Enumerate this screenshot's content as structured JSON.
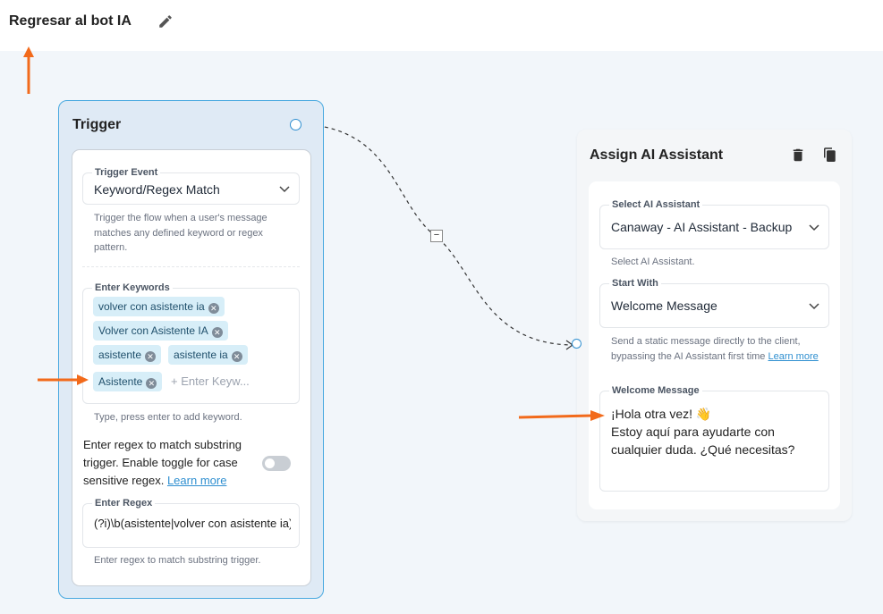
{
  "header": {
    "back_label": "Regresar al bot IA",
    "edit_icon": "pencil-icon"
  },
  "trigger_node": {
    "title": "Trigger",
    "event_label": "Trigger Event",
    "event_value": "Keyword/Regex Match",
    "event_help": "Trigger the flow when a user's message matches any defined keyword or regex pattern.",
    "keywords_label": "Enter Keywords",
    "keywords": [
      "volver con asistente ia",
      "Volver con Asistente IA",
      "asistente",
      "asistente ia",
      "Asistente"
    ],
    "keywords_placeholder": "+ Enter Keyw...",
    "keywords_help": "Type, press enter to add keyword.",
    "regex_toggle_text": "Enter regex to match substring trigger. Enable toggle for case sensitive regex.",
    "learn_more": "Learn more",
    "regex_toggle_on": false,
    "regex_label": "Enter Regex",
    "regex_value": "(?i)\\b(asistente|volver con asistente ia)\\b",
    "regex_help": "Enter regex to match substring trigger."
  },
  "connector": {
    "remove_label": "−"
  },
  "assign_node": {
    "title": "Assign AI Assistant",
    "select_label": "Select AI Assistant",
    "select_value": "Canaway - AI Assistant - Backup",
    "select_help": "Select AI Assistant.",
    "start_label": "Start With",
    "start_value": "Welcome Message",
    "start_help": "Send a static message directly to the client, bypassing the AI Assistant first time",
    "learn_more": "Learn more",
    "welcome_label": "Welcome Message",
    "welcome_line1": "¡Hola otra vez! 👋",
    "welcome_line2": "Estoy aquí para ayudarte con",
    "welcome_line3": "cualquier duda. ¿Qué necesitas?"
  },
  "colors": {
    "accent": "#2f8fd0",
    "annotation_arrow": "#f26a1b",
    "chip_bg": "#d7eef8"
  }
}
